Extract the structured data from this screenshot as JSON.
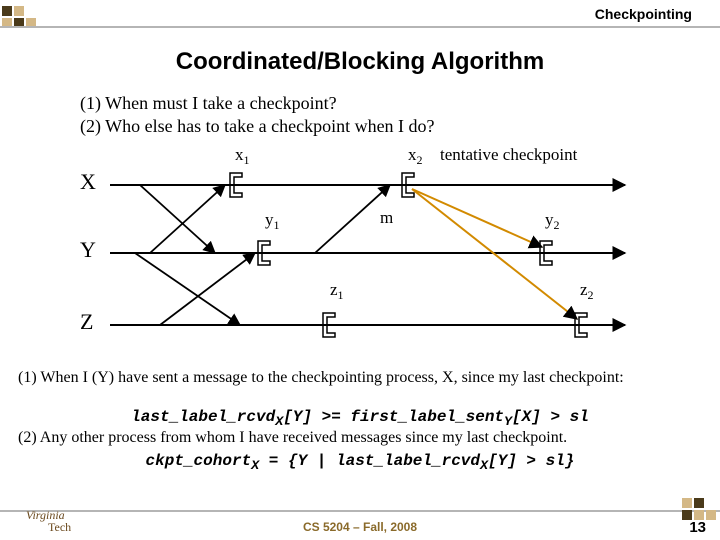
{
  "header": {
    "label": "Checkpointing"
  },
  "title": "Coordinated/Blocking Algorithm",
  "questions": {
    "q1": "(1) When must I take a checkpoint?",
    "q2": "(2) Who else has to take a checkpoint when I do?"
  },
  "diagram": {
    "processes": {
      "X": "X",
      "Y": "Y",
      "Z": "Z"
    },
    "labels": {
      "x1": "x",
      "x1_sub": "1",
      "x2": "x",
      "x2_sub": "2",
      "y1": "y",
      "y1_sub": "1",
      "y2": "y",
      "y2_sub": "2",
      "z1": "z",
      "z1_sub": "1",
      "z2": "z",
      "z2_sub": "2",
      "m": "m",
      "tentative": "tentative checkpoint"
    }
  },
  "body": {
    "line1": "(1) When I (Y) have sent a message to the checkpointing process, X, since my last checkpoint:",
    "cond1_pre": "last_label_rcvd",
    "cond1_sub1": "X",
    "cond1_mid1": "[Y] >= first_label_sent",
    "cond1_sub2": "Y",
    "cond1_mid2": "[X] > sl",
    "line2": "(2) Any other process from whom I have received messages since my last checkpoint.",
    "cond2_pre": "ckpt_cohort",
    "cond2_sub1": "X",
    "cond2_mid1": " = {Y | last_label_rcvd",
    "cond2_sub2": "X",
    "cond2_mid2": "[Y] > sl}"
  },
  "footer": {
    "logo_top": "Virginia",
    "logo_bot": "Tech",
    "course": "CS 5204 – Fall, 2008",
    "page": "13"
  }
}
